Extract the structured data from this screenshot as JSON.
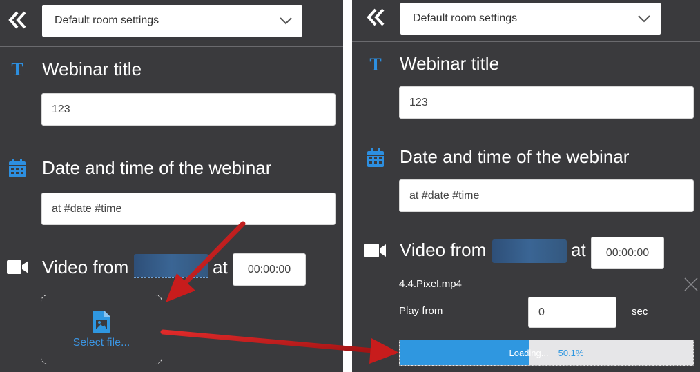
{
  "left": {
    "room_select": "Default room settings",
    "webinar_title_label": "Webinar title",
    "webinar_title_value": "123",
    "datetime_label": "Date and time of the webinar",
    "datetime_value": "at #date #time",
    "video_from_label": "Video from",
    "at_label": "at",
    "time_value": "00:00:00",
    "select_file_label": "Select file..."
  },
  "right": {
    "room_select": "Default room settings",
    "webinar_title_label": "Webinar title",
    "webinar_title_value": "123",
    "datetime_label": "Date and time of the webinar",
    "datetime_value": "at #date #time",
    "video_from_label": "Video from",
    "at_label": "at",
    "time_value": "00:00:00",
    "file_name": "4.4.Pixel.mp4",
    "play_from_label": "Play from",
    "play_from_value": "0",
    "sec_label": "sec",
    "loading_label": "Loading...",
    "progress_text": "50.1%",
    "progress_value": 0.441
  },
  "icons": {
    "collapse": "double-chevron-left-icon",
    "dropdown": "chevron-down-icon",
    "title": "text-t-icon",
    "date": "calendar-icon",
    "video": "video-camera-icon",
    "file": "file-image-icon",
    "close": "close-icon"
  },
  "colors": {
    "panel_bg": "#3a3a3d",
    "accent_blue": "#2f97e0",
    "arrow_red": "#cc1f1f",
    "progress_track": "#e6e6e8"
  }
}
